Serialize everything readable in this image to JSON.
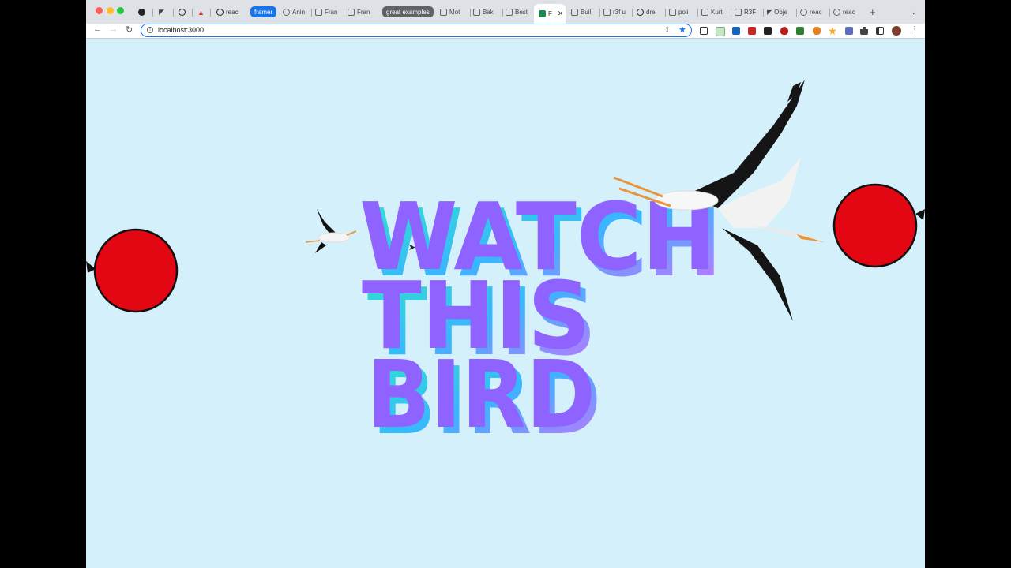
{
  "browser": {
    "tabs": [
      {
        "label": "",
        "icon": "circle-icon"
      },
      {
        "label": "",
        "icon": "framer-icon"
      },
      {
        "label": "",
        "icon": "github-icon"
      },
      {
        "label": "",
        "icon": "triangle-icon"
      },
      {
        "label": "reac",
        "icon": "github-icon"
      },
      {
        "label": "framer",
        "group": true
      },
      {
        "label": "Anin",
        "icon": "globe-icon"
      },
      {
        "label": "Fran",
        "icon": "page-icon"
      },
      {
        "label": "Fran",
        "icon": "page-icon"
      },
      {
        "label": "great examples",
        "group": true
      },
      {
        "label": "Mot",
        "icon": "page-icon"
      },
      {
        "label": "Bak",
        "icon": "page-icon"
      },
      {
        "label": "Best",
        "icon": "page-icon"
      },
      {
        "label": "F",
        "icon": "codesandbox-icon",
        "active": true
      },
      {
        "label": "Buil",
        "icon": "page-icon"
      },
      {
        "label": "r3f u",
        "icon": "page-icon"
      },
      {
        "label": "drei",
        "icon": "github-icon"
      },
      {
        "label": "poli",
        "icon": "page-icon"
      },
      {
        "label": "Kurt",
        "icon": "page-icon"
      },
      {
        "label": "R3F",
        "icon": "page-icon"
      },
      {
        "label": "Obje",
        "icon": "framer-icon"
      },
      {
        "label": "reac",
        "icon": "globe-icon"
      },
      {
        "label": "reac",
        "icon": "globe-icon"
      }
    ],
    "url": "localhost:3000",
    "new_tab_symbol": "+",
    "tab_menu_symbol": "⌄"
  },
  "scene": {
    "headline": [
      "WATCH",
      "THIS",
      "BIRD"
    ],
    "text_color": "#8f63ff",
    "background": "#d4f1fb",
    "ball_color": "#e30613"
  }
}
